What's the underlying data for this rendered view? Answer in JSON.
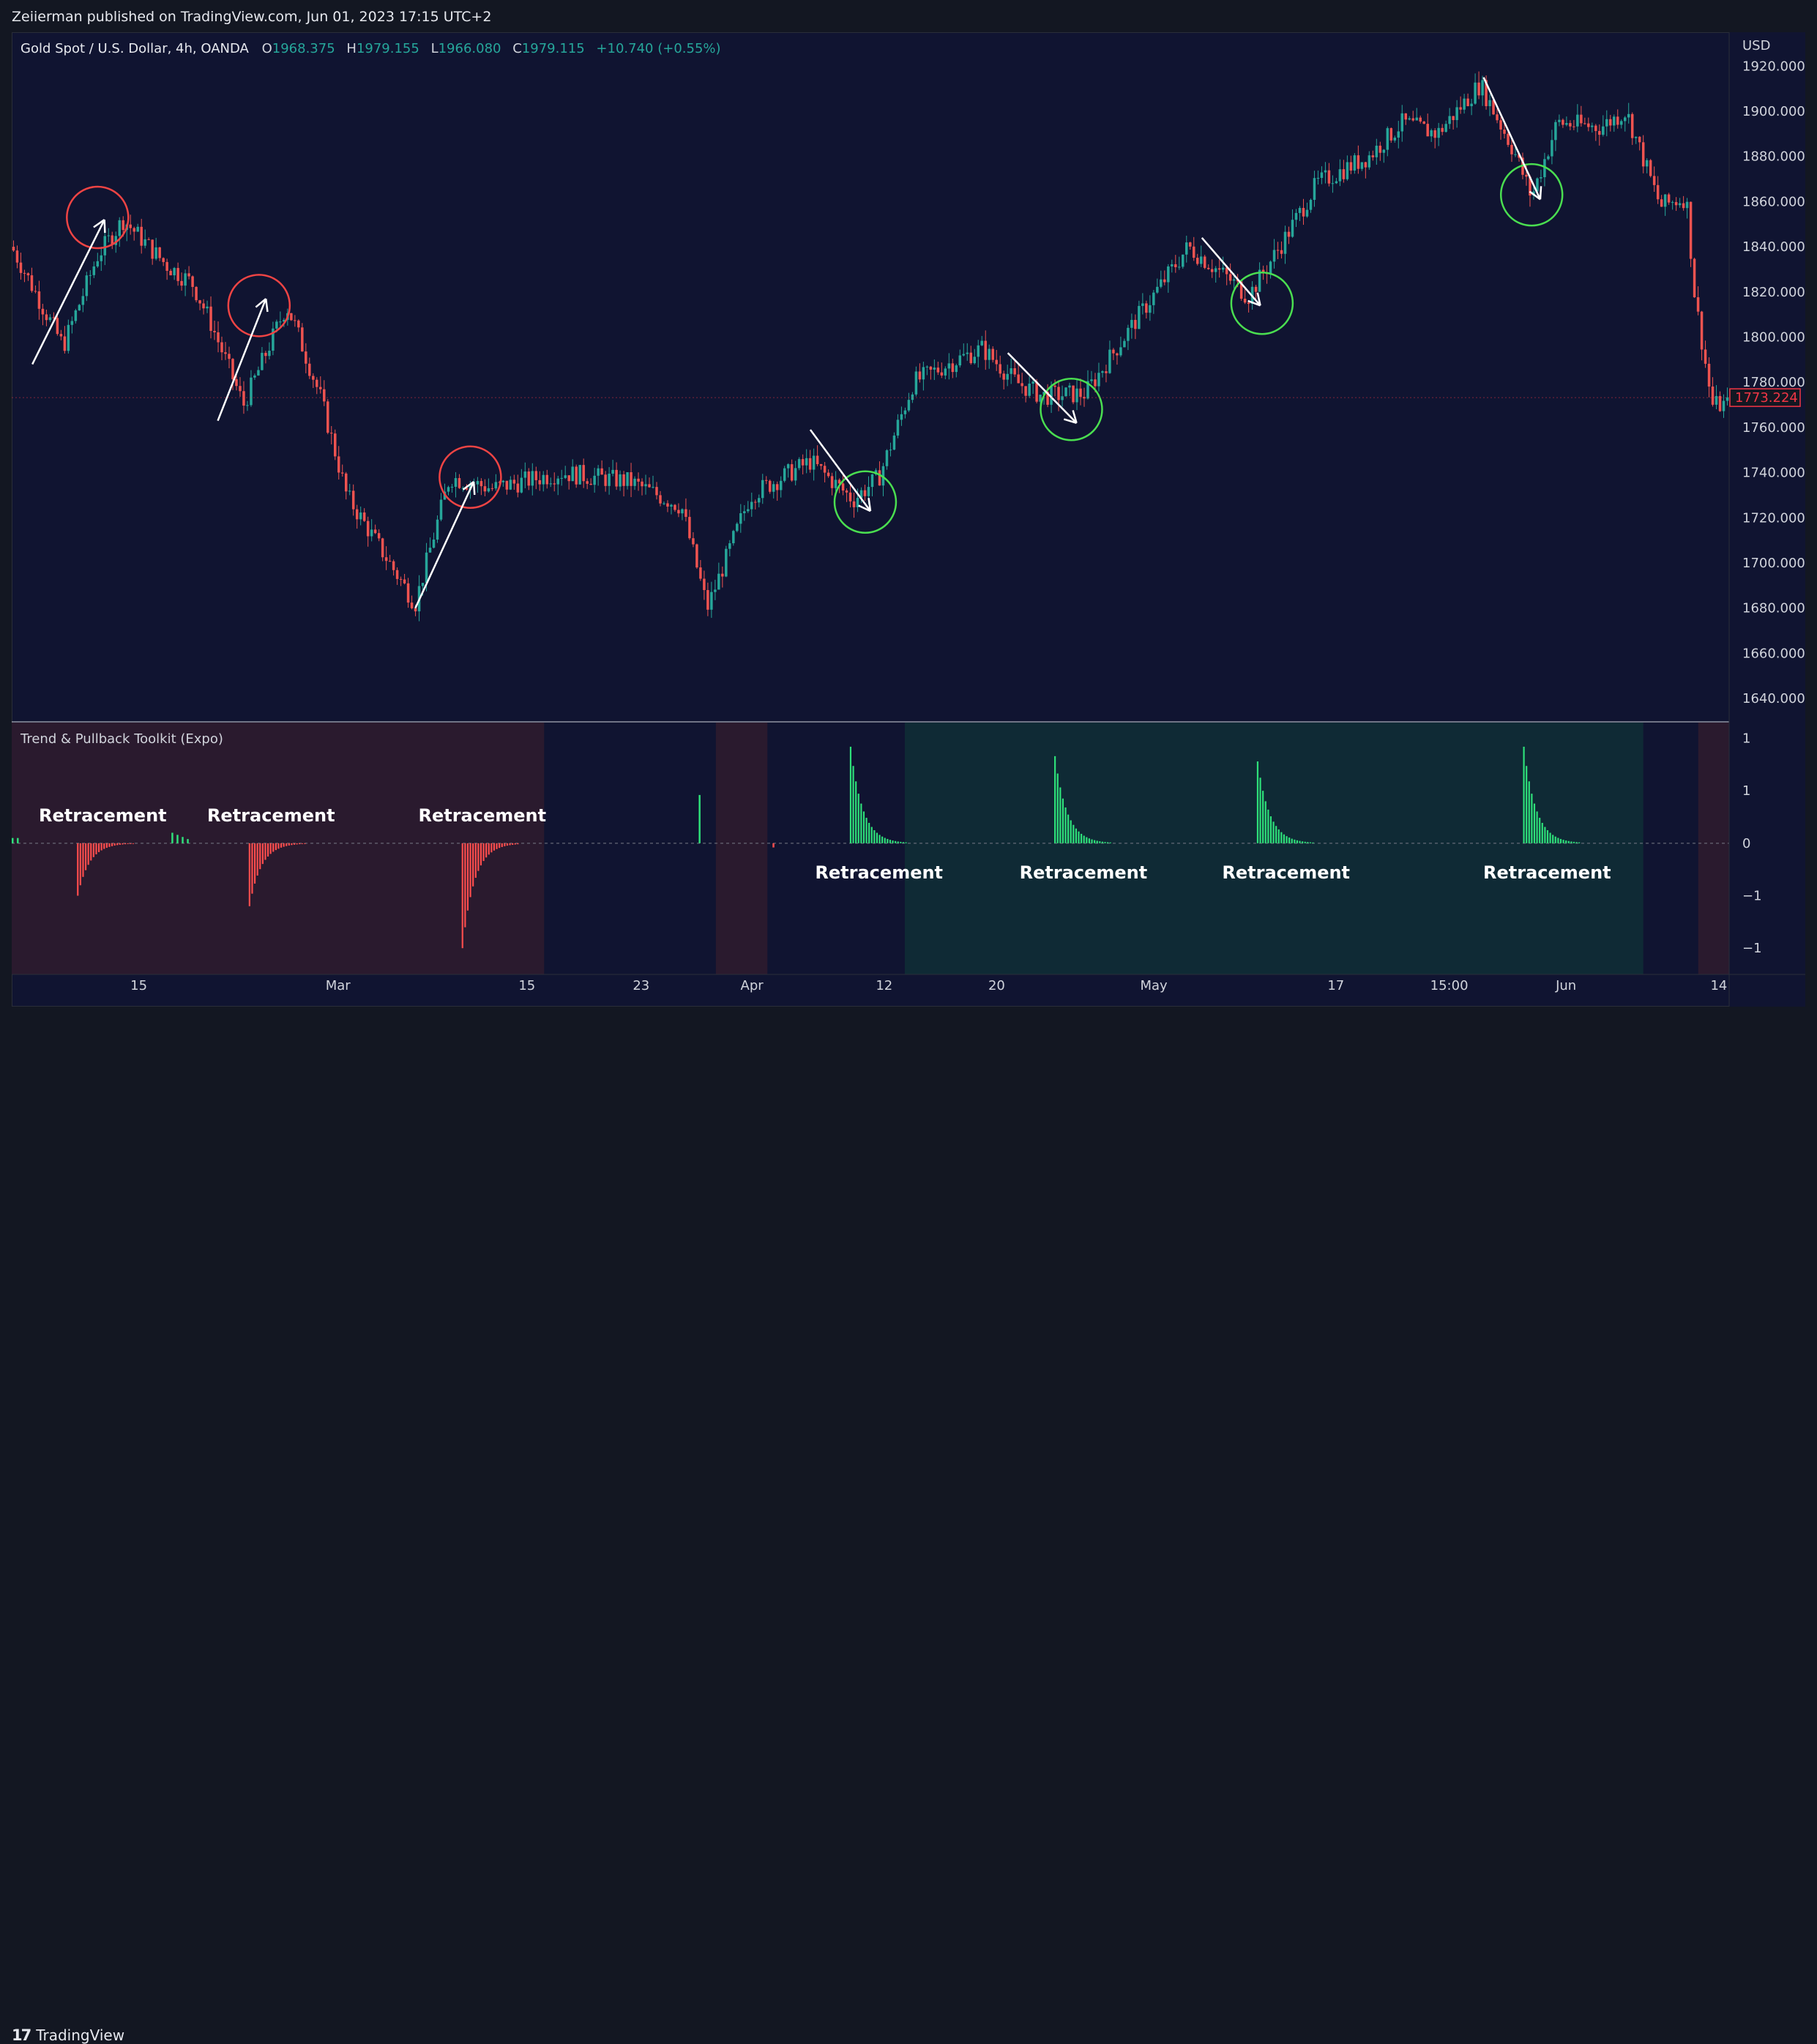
{
  "header": {
    "publisher_text": "Zeiierman published on TradingView.com, Jun 01, 2023 17:15 UTC+2"
  },
  "legend": {
    "symbol": "Gold Spot / U.S. Dollar, 4h, OANDA",
    "open_label": "O",
    "open": "1968.375",
    "high_label": "H",
    "high": "1979.155",
    "low_label": "L",
    "low": "1966.080",
    "close_label": "C",
    "close": "1979.115",
    "change": "+10.740 (+0.55%)"
  },
  "indicator": {
    "title": "Trend & Pullback Toolkit (Expo)"
  },
  "footer": {
    "brand": "TradingView",
    "logo_glyph": "17"
  },
  "colors": {
    "bg": "#101431",
    "up": "#26a69a",
    "down": "#ef5350",
    "bear_zone": "#2a1a2e",
    "bull_zone": "#0f2a35",
    "hist_up": "#2ee07a",
    "hist_down": "#ff4d4d",
    "price_tag": "#f23645"
  },
  "chart_data": [
    {
      "type": "candlestick",
      "symbol": "XAUUSD",
      "currency_label": "USD",
      "ylim": [
        1630,
        1935
      ],
      "y_ticks": [
        "1640.000",
        "1660.000",
        "1680.000",
        "1700.000",
        "1720.000",
        "1740.000",
        "1760.000",
        "1780.000",
        "1800.000",
        "1820.000",
        "1840.000",
        "1860.000",
        "1880.000",
        "1900.000",
        "1920.000"
      ],
      "x_ticks": [
        "15",
        "Mar",
        "15",
        "23",
        "Apr",
        "12",
        "20",
        "May",
        "17",
        "15:00",
        "Jun",
        "14"
      ],
      "last_price": "1773.224",
      "price_path": [
        {
          "t": 0,
          "p": 1840
        },
        {
          "t": 0.03,
          "p": 1796
        },
        {
          "t": 0.05,
          "p": 1836
        },
        {
          "t": 0.065,
          "p": 1852
        },
        {
          "t": 0.09,
          "p": 1832
        },
        {
          "t": 0.105,
          "p": 1824
        },
        {
          "t": 0.115,
          "p": 1808
        },
        {
          "t": 0.135,
          "p": 1770
        },
        {
          "t": 0.16,
          "p": 1814
        },
        {
          "t": 0.165,
          "p": 1805
        },
        {
          "t": 0.18,
          "p": 1773
        },
        {
          "t": 0.195,
          "p": 1730
        },
        {
          "t": 0.22,
          "p": 1700
        },
        {
          "t": 0.235,
          "p": 1682
        },
        {
          "t": 0.255,
          "p": 1738
        },
        {
          "t": 0.28,
          "p": 1733
        },
        {
          "t": 0.32,
          "p": 1740
        },
        {
          "t": 0.36,
          "p": 1736
        },
        {
          "t": 0.39,
          "p": 1725
        },
        {
          "t": 0.405,
          "p": 1680
        },
        {
          "t": 0.43,
          "p": 1730
        },
        {
          "t": 0.465,
          "p": 1745
        },
        {
          "t": 0.49,
          "p": 1728
        },
        {
          "t": 0.505,
          "p": 1738
        },
        {
          "t": 0.525,
          "p": 1780
        },
        {
          "t": 0.545,
          "p": 1788
        },
        {
          "t": 0.565,
          "p": 1795
        },
        {
          "t": 0.585,
          "p": 1780
        },
        {
          "t": 0.6,
          "p": 1774
        },
        {
          "t": 0.625,
          "p": 1775
        },
        {
          "t": 0.655,
          "p": 1808
        },
        {
          "t": 0.685,
          "p": 1840
        },
        {
          "t": 0.71,
          "p": 1825
        },
        {
          "t": 0.72,
          "p": 1818
        },
        {
          "t": 0.74,
          "p": 1842
        },
        {
          "t": 0.76,
          "p": 1868
        },
        {
          "t": 0.79,
          "p": 1880
        },
        {
          "t": 0.81,
          "p": 1895
        },
        {
          "t": 0.83,
          "p": 1890
        },
        {
          "t": 0.855,
          "p": 1912
        },
        {
          "t": 0.875,
          "p": 1882
        },
        {
          "t": 0.885,
          "p": 1862
        },
        {
          "t": 0.9,
          "p": 1895
        },
        {
          "t": 0.925,
          "p": 1893
        },
        {
          "t": 0.94,
          "p": 1900
        },
        {
          "t": 0.96,
          "p": 1858
        },
        {
          "t": 0.975,
          "p": 1862
        },
        {
          "t": 0.98,
          "p": 1818
        },
        {
          "t": 0.99,
          "p": 1770
        },
        {
          "t": 1.0,
          "p": 1770
        }
      ],
      "annotations": {
        "red_circles": [
          {
            "t": 0.05,
            "p": 1853
          },
          {
            "t": 0.144,
            "p": 1814
          },
          {
            "t": 0.267,
            "p": 1738
          }
        ],
        "green_circles": [
          {
            "t": 0.497,
            "p": 1727
          },
          {
            "t": 0.617,
            "p": 1768
          },
          {
            "t": 0.728,
            "p": 1815
          },
          {
            "t": 0.885,
            "p": 1863
          }
        ],
        "up_arrows": [
          [
            {
              "t": 0.012,
              "p": 1788
            },
            {
              "t": 0.054,
              "p": 1852
            }
          ],
          [
            {
              "t": 0.12,
              "p": 1763
            },
            {
              "t": 0.148,
              "p": 1817
            }
          ],
          [
            {
              "t": 0.235,
              "p": 1680
            },
            {
              "t": 0.269,
              "p": 1736
            }
          ]
        ],
        "down_arrows": [
          [
            {
              "t": 0.465,
              "p": 1759
            },
            {
              "t": 0.5,
              "p": 1723
            }
          ],
          [
            {
              "t": 0.58,
              "p": 1793
            },
            {
              "t": 0.62,
              "p": 1762
            }
          ],
          [
            {
              "t": 0.693,
              "p": 1844
            },
            {
              "t": 0.727,
              "p": 1814
            }
          ],
          [
            {
              "t": 0.857,
              "p": 1915
            },
            {
              "t": 0.89,
              "p": 1861
            }
          ]
        ]
      }
    },
    {
      "type": "bar",
      "title": "Trend & Pullback Toolkit (Expo)",
      "ylim": [
        -1.25,
        1.15
      ],
      "y_tick_labels": [
        "1",
        "1",
        "0",
        "−1",
        "−1"
      ],
      "y_tick_values": [
        1.0,
        0.5,
        0,
        -0.5,
        -1.0
      ],
      "zones": [
        {
          "from": 0.0,
          "to": 0.31,
          "kind": "bear"
        },
        {
          "from": 0.41,
          "to": 0.44,
          "kind": "bear"
        },
        {
          "from": 0.52,
          "to": 0.95,
          "kind": "bull"
        },
        {
          "from": 0.982,
          "to": 1.0,
          "kind": "bear"
        }
      ],
      "pulses": [
        {
          "t": 0.038,
          "peak": -0.5,
          "dir": "down"
        },
        {
          "t": 0.138,
          "peak": -0.6,
          "dir": "down"
        },
        {
          "t": 0.262,
          "peak": -1.0,
          "dir": "down"
        },
        {
          "t": 0.488,
          "peak": 0.92,
          "dir": "up"
        },
        {
          "t": 0.607,
          "peak": 0.83,
          "dir": "up"
        },
        {
          "t": 0.725,
          "peak": 0.78,
          "dir": "up"
        },
        {
          "t": 0.88,
          "peak": 0.92,
          "dir": "up"
        }
      ],
      "small_bars": [
        {
          "t": 0.0,
          "v": 0.05
        },
        {
          "t": 0.003,
          "v": 0.05
        },
        {
          "t": 0.093,
          "v": 0.1
        },
        {
          "t": 0.096,
          "v": 0.08
        },
        {
          "t": 0.099,
          "v": 0.06
        },
        {
          "t": 0.102,
          "v": 0.04
        },
        {
          "t": 0.4,
          "v": 0.46
        },
        {
          "t": 0.443,
          "v": -0.04
        }
      ],
      "labels": [
        {
          "text": "Retracement",
          "t": 0.053,
          "pos": "above"
        },
        {
          "text": "Retracement",
          "t": 0.151,
          "pos": "above"
        },
        {
          "text": "Retracement",
          "t": 0.274,
          "pos": "above"
        },
        {
          "text": "Retracement",
          "t": 0.505,
          "pos": "below"
        },
        {
          "text": "Retracement",
          "t": 0.624,
          "pos": "below"
        },
        {
          "text": "Retracement",
          "t": 0.742,
          "pos": "below"
        },
        {
          "text": "Retracement",
          "t": 0.894,
          "pos": "below"
        }
      ]
    }
  ]
}
